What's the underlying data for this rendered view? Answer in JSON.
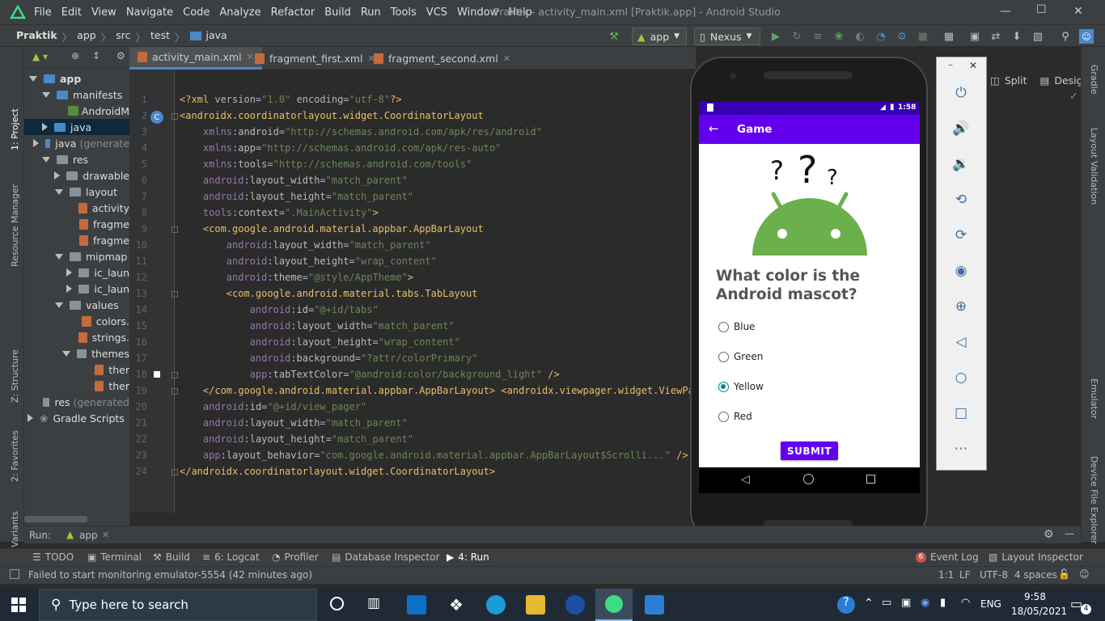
{
  "menubar": {
    "items": [
      "File",
      "Edit",
      "View",
      "Navigate",
      "Code",
      "Analyze",
      "Refactor",
      "Build",
      "Run",
      "Tools",
      "VCS",
      "Window",
      "Help"
    ],
    "window_title": "Praktik - activity_main.xml [Praktik.app] - Android Studio"
  },
  "navbar": {
    "crumbs": [
      "Praktik",
      "app",
      "src",
      "test",
      "java"
    ],
    "run_config": "app",
    "device": "Nexus"
  },
  "left_tool_tabs": [
    "1: Project",
    "Resource Manager",
    "Z: Structure",
    "2: Favorites",
    "Build Variants"
  ],
  "right_tool_tabs": [
    "Gradle",
    "Layout Validation",
    "Emulator",
    "Device File Explorer"
  ],
  "project_tree": {
    "rows": [
      {
        "label": "app",
        "indent": 0
      },
      {
        "label": "manifests",
        "indent": 1
      },
      {
        "label": "AndroidM",
        "indent": 2
      },
      {
        "label": "java",
        "indent": 1
      },
      {
        "label": "java",
        "suffix": "(generate",
        "indent": 1
      },
      {
        "label": "res",
        "indent": 1
      },
      {
        "label": "drawable",
        "indent": 2
      },
      {
        "label": "layout",
        "indent": 2
      },
      {
        "label": "activity",
        "indent": 3
      },
      {
        "label": "fragme",
        "indent": 3
      },
      {
        "label": "fragme",
        "indent": 3
      },
      {
        "label": "mipmap",
        "indent": 2
      },
      {
        "label": "ic_laun",
        "indent": 3
      },
      {
        "label": "ic_laun",
        "indent": 3
      },
      {
        "label": "values",
        "indent": 2
      },
      {
        "label": "colors.",
        "indent": 3
      },
      {
        "label": "strings.",
        "indent": 3
      },
      {
        "label": "themes",
        "indent": 3
      },
      {
        "label": "ther",
        "indent": 4
      },
      {
        "label": "ther",
        "indent": 4
      },
      {
        "label": "res",
        "suffix": "(generated",
        "indent": 1
      },
      {
        "label": "Gradle Scripts",
        "indent": 0
      }
    ]
  },
  "editor_tabs": [
    "activity_main.xml",
    "fragment_first.xml",
    "fragment_second.xml"
  ],
  "view_modes": [
    "Split",
    "Design"
  ],
  "code_lines": [
    "<?xml version=\"1.0\" encoding=\"utf-8\"?>",
    "<androidx.coordinatorlayout.widget.CoordinatorLayout",
    "    xmlns:android=\"http://schemas.android.com/apk/res/android\"",
    "    xmlns:app=\"http://schemas.android.com/apk/res-auto\"",
    "    xmlns:tools=\"http://schemas.android.com/tools\"",
    "    android:layout_width=\"match_parent\"",
    "    android:layout_height=\"match_parent\"",
    "    tools:context=\".MainActivity\">",
    "    <com.google.android.material.appbar.AppBarLayout",
    "        android:layout_width=\"match_parent\"",
    "        android:layout_height=\"wrap_content\"",
    "        android:theme=\"@style/AppTheme\">",
    "        <com.google.android.material.tabs.TabLayout",
    "            android:id=\"@+id/tabs\"",
    "            android:layout_width=\"match_parent\"",
    "            android:layout_height=\"wrap_content\"",
    "            android:background=\"?attr/colorPrimary\"",
    "            app:tabTextColor=\"@android:color/background_light\" />",
    "    </com.google.android.material.appbar.AppBarLayout> <androidx.viewpager.widget.ViewPage",
    "    android:id=\"@+id/view_pager\"",
    "    android:layout_width=\"match_parent\"",
    "    android:layout_height=\"match_parent\"",
    "    app:layout_behavior=\"com.google.android.material.appbar.AppBarLayout$Scrolli...\" />",
    "</androidx.coordinatorlayout.widget.CoordinatorLayout>"
  ],
  "phone": {
    "time": "1:58",
    "app_title": "Game",
    "question": "What color is the Android mascot?",
    "options": [
      "Blue",
      "Green",
      "Yellow",
      "Red"
    ],
    "selected_option": "Yellow",
    "submit_label": "SUBMIT",
    "primary_color": "#6200ee",
    "status_color": "#3700b3",
    "mascot_color": "#6ab04c"
  },
  "run_bar": {
    "label": "Run:",
    "config": "app"
  },
  "bottom_tools": [
    "TODO",
    "Terminal",
    "Build",
    "6: Logcat",
    "Profiler",
    "Database Inspector",
    "4: Run"
  ],
  "bottom_right_tools": {
    "event_log_count": "6",
    "event_log": "Event Log",
    "layout_inspector": "Layout Inspector"
  },
  "status": {
    "message": "Failed to start monitoring emulator-5554 (42 minutes ago)",
    "position": "1:1",
    "line_sep": "LF",
    "encoding": "UTF-8",
    "indent": "4 spaces"
  },
  "taskbar": {
    "search_placeholder": "Type here to search",
    "language": "ENG",
    "time": "9:58",
    "date": "18/05/2021",
    "notifications": "4"
  }
}
